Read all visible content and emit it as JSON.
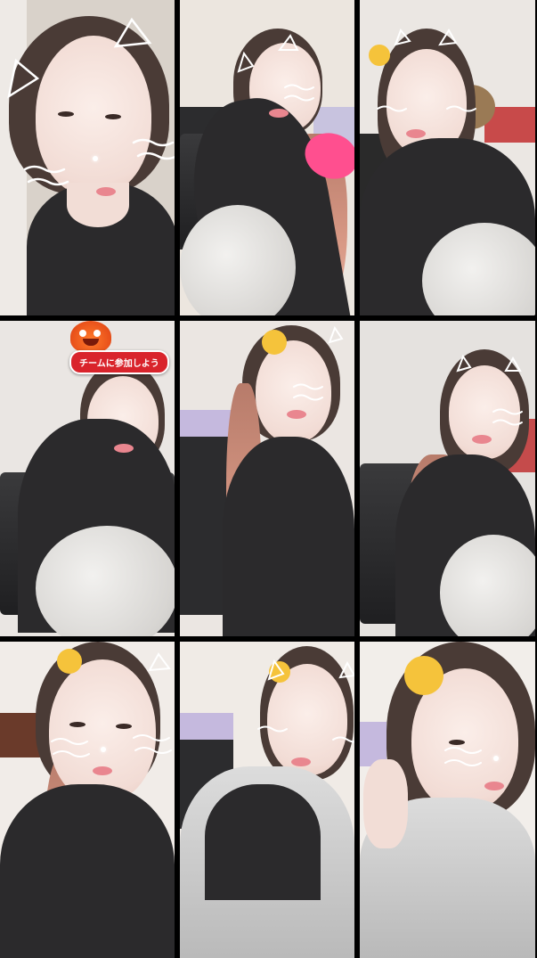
{
  "call": {
    "tiles": [
      {
        "id": "tile-1",
        "theme": "selfie-close",
        "colors": {
          "wall": "#d9d2ca"
        }
      },
      {
        "id": "tile-2",
        "theme": "reclining-sofa",
        "colors": {
          "wall": "#ece6df"
        }
      },
      {
        "id": "tile-3",
        "theme": "sitting-knee-up",
        "colors": {
          "wall": "#ebe7e3"
        }
      },
      {
        "id": "tile-4",
        "theme": "arm-behind-head",
        "colors": {
          "wall": "#eae6e3"
        }
      },
      {
        "id": "tile-5",
        "theme": "leaning-forward",
        "colors": {
          "wall": "#ebe6e2"
        }
      },
      {
        "id": "tile-6",
        "theme": "hand-on-forehead",
        "colors": {
          "wall": "#e5e2df"
        }
      },
      {
        "id": "tile-7",
        "theme": "close-selfie-pink-hair",
        "colors": {
          "wall": "#f1ece8"
        }
      },
      {
        "id": "tile-8",
        "theme": "grey-hoodie",
        "colors": {
          "wall": "#f0ebe6"
        }
      },
      {
        "id": "tile-9",
        "theme": "hoodie-hand-on-ear",
        "colors": {
          "wall": "#f2eeea"
        }
      }
    ],
    "team_badge": {
      "label": "チームに参加しよう",
      "colors": {
        "badge": "#d9242c",
        "mascot": "#e8501a"
      }
    },
    "filter": {
      "icon": "cat-ears-whiskers-icon",
      "accent": "#ffffff"
    }
  }
}
